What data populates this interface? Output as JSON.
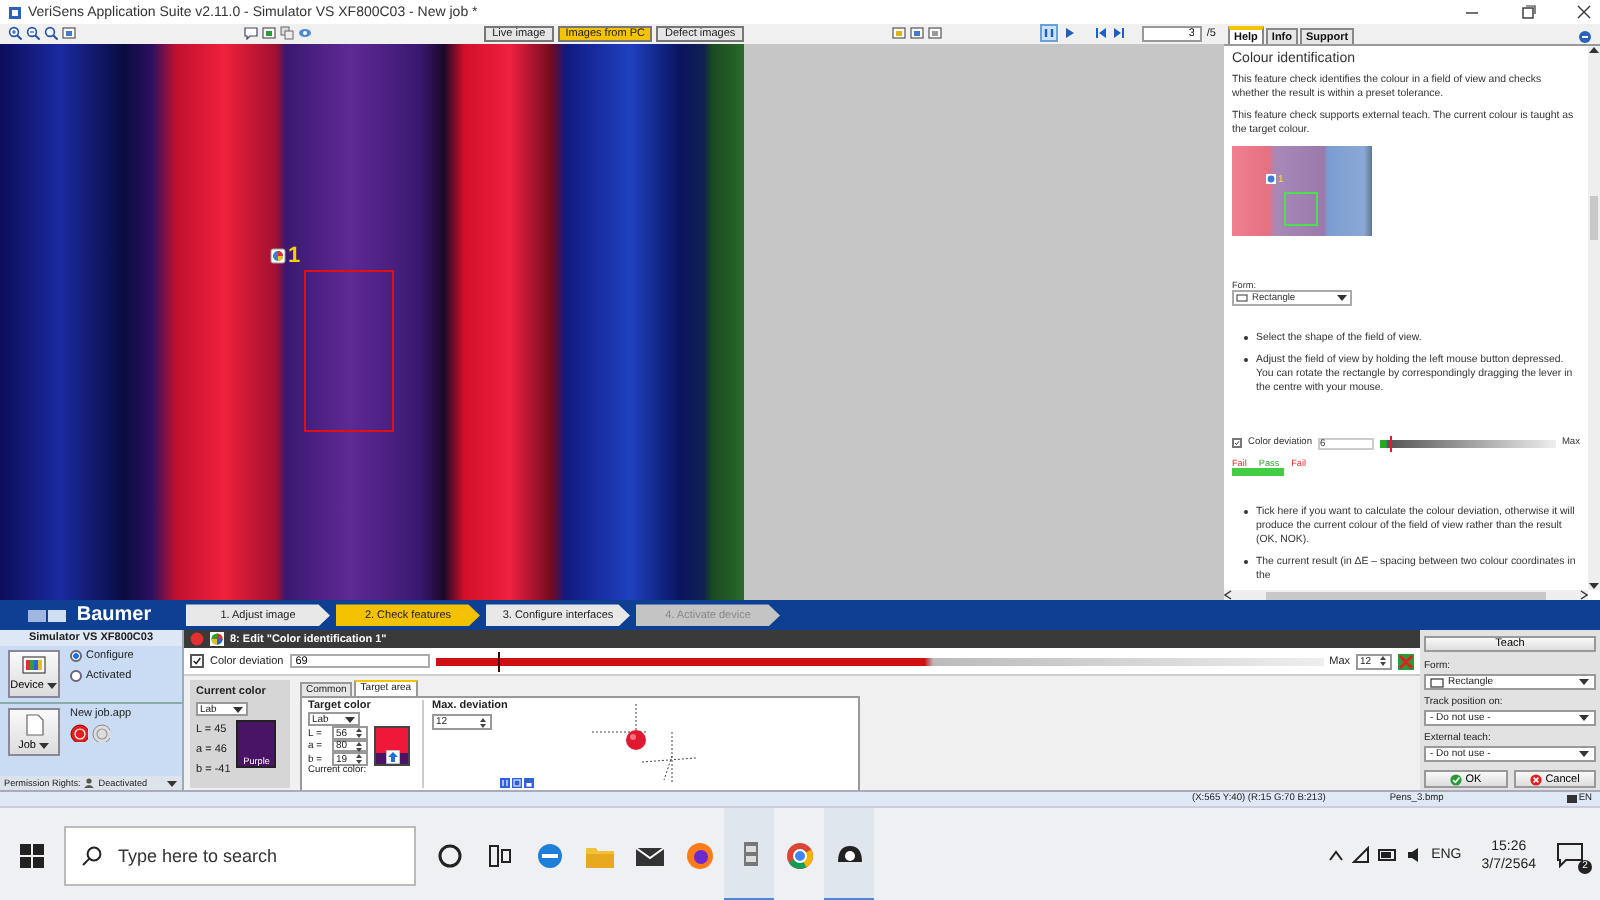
{
  "window": {
    "title": "VeriSens Application Suite v2.11.0 - Simulator VS XF800C03 - New job *"
  },
  "image_sources": [
    {
      "label": "Live image",
      "selected": false
    },
    {
      "label": "Images from PC",
      "selected": true
    },
    {
      "label": "Defect images",
      "selected": false
    }
  ],
  "image_navigation": {
    "current": "3",
    "total": "/5"
  },
  "image_view": {
    "feature_marker": "1"
  },
  "help_panel": {
    "tabs": [
      {
        "label": "Help",
        "selected": true
      },
      {
        "label": "Info",
        "selected": false
      },
      {
        "label": "Support",
        "selected": false
      }
    ],
    "title": "Colour identification",
    "paragraphs": [
      "This feature check identifies the colour in a field of view and checks whether the result is within a preset tolerance.",
      "This feature check supports external teach. The current colour is taught as the target colour."
    ],
    "figure": {
      "marker": "1"
    },
    "form_example": {
      "label": "Form:",
      "value": "Rectangle"
    },
    "bullets_1": [
      "Select the shape of the field of view.",
      "Adjust the field of view by holding the left mouse button depressed. You can rotate the rectangle by correspondingly dragging the lever in the centre with your mouse."
    ],
    "deviation_example": {
      "checked": true,
      "label": "Color deviation",
      "value": "6",
      "max_label": "Max",
      "level": 0.06,
      "scale": [
        "Fail",
        "Pass",
        "Fail"
      ]
    },
    "bullets_2": [
      "Tick here if you want to calculate the colour deviation, otherwise it will produce the current colour of the field of view rather than the result (OK, NOK).",
      "The current result (in ΔE – spacing between two colour coordinates in the"
    ]
  },
  "brand": "Baumer",
  "steps": [
    {
      "label": "1. Adjust image",
      "selected": false,
      "disabled": false
    },
    {
      "label": "2. Check features",
      "selected": true,
      "disabled": false
    },
    {
      "label": "3. Configure interfaces",
      "selected": false,
      "disabled": false
    },
    {
      "label": "4. Activate device",
      "selected": false,
      "disabled": true
    }
  ],
  "device_panel": {
    "title": "Simulator VS XF800C03",
    "device_button": "Device",
    "modes": [
      {
        "label": "Configure",
        "selected": true
      },
      {
        "label": "Activated",
        "selected": false
      }
    ],
    "job_file": "New job.app",
    "job_button": "Job",
    "permission": {
      "label": "Permission Rights:",
      "value": "Deactivated"
    }
  },
  "editor": {
    "step_title": "8: Edit \"Color identification 1\"",
    "deviation": {
      "checked": true,
      "label": "Color deviation",
      "value": "69",
      "level": 0.07,
      "max_label": "Max",
      "max_value": "12"
    },
    "current_color": {
      "title": "Current color",
      "space": "Lab",
      "readings": [
        "L = 45",
        "a = 46",
        "b = -41"
      ],
      "swatch_label": "Purple"
    },
    "tabs": [
      {
        "label": "Common",
        "selected": false
      },
      {
        "label": "Target area",
        "selected": true
      }
    ],
    "target_color": {
      "title": "Target color",
      "space": "Lab",
      "channels": [
        {
          "label": "L =",
          "value": "56"
        },
        {
          "label": "a =",
          "value": "80"
        },
        {
          "label": "b =",
          "value": "19"
        }
      ],
      "current_label": "Current color:"
    },
    "max_deviation": {
      "title": "Max. deviation",
      "value": "12"
    }
  },
  "options": {
    "teach_button": "Teach",
    "fields": [
      {
        "label": "Form:",
        "value": "Rectangle",
        "kind": "shape"
      },
      {
        "label": "Track position on:",
        "value": "- Do not use -",
        "kind": "plain"
      },
      {
        "label": "External teach:",
        "value": "- Do not use -",
        "kind": "plain"
      }
    ],
    "buttons": [
      {
        "label": "OK",
        "kind": "ok"
      },
      {
        "label": "Cancel",
        "kind": "cancel"
      }
    ]
  },
  "status_bar": {
    "coordinates": "(X:565 Y:40) (R:15 G:70 B:213)",
    "file": "Pens_3.bmp",
    "language": "EN"
  },
  "taskbar": {
    "search_placeholder": "Type here to search",
    "language": "ENG",
    "time": "15:26",
    "date": "3/7/2564",
    "notifications": "2"
  }
}
